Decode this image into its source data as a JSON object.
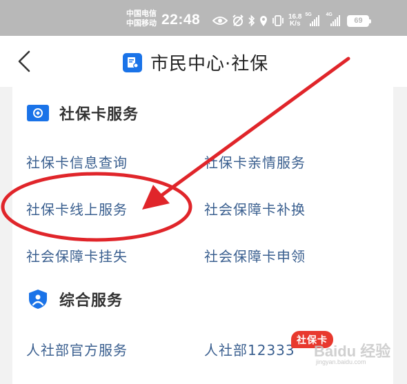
{
  "status_bar": {
    "carrier1": "中国电信",
    "carrier2": "中国移动",
    "time": "22:48",
    "net_speed_value": "16.8",
    "net_speed_unit": "K/s",
    "sim1_tag": "5G",
    "sim2_tag": "4G",
    "battery": "69"
  },
  "nav": {
    "title": "市民中心·社保"
  },
  "sections": {
    "social_card": {
      "title": "社保卡服务",
      "items": [
        "社保卡信息查询",
        "社保卡亲情服务",
        "社保卡线上服务",
        "社会保障卡补换",
        "社会保障卡挂失",
        "社会保障卡申领"
      ]
    },
    "general": {
      "title": "综合服务",
      "items": [
        "人社部官方服务",
        "人社部12333"
      ],
      "badge": "社保卡"
    }
  },
  "annotation_color": "#e0252a",
  "accent_color": "#1a73e8",
  "watermark": {
    "brand": "Baidu 经验",
    "url": "jingyan.baidu.com"
  }
}
